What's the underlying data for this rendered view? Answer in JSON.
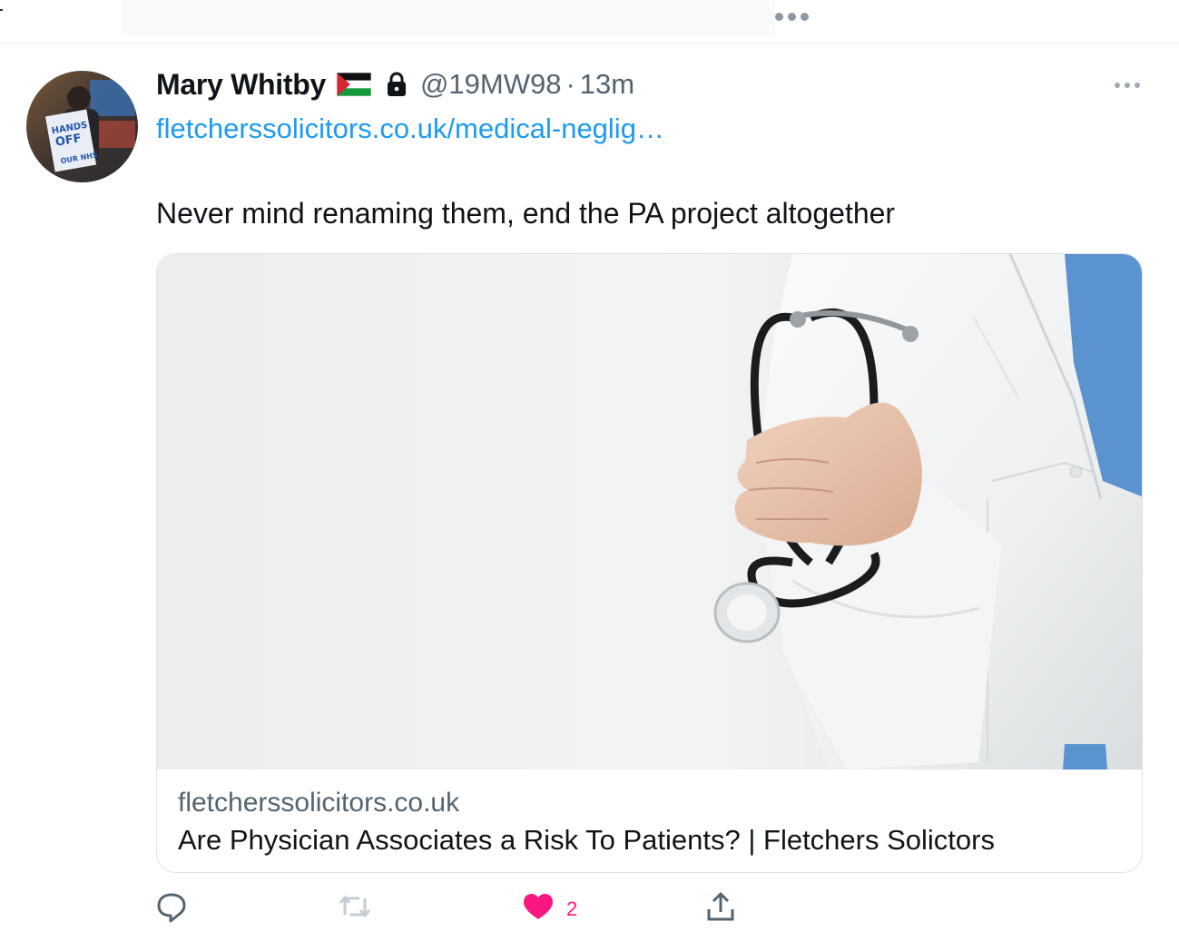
{
  "tweet": {
    "author_name": "Mary Whitby",
    "handle": "@19MW98",
    "separator": "·",
    "time": "13m",
    "link_text": "fletcherssolicitors.co.uk/medical-neglig…",
    "text": "Never mind renaming them, end the PA project altogether",
    "flag_icon": "palestine-flag-icon",
    "protected_icon": "lock-icon"
  },
  "card": {
    "domain": "fletcherssolicitors.co.uk",
    "title": "Are Physician Associates a Risk To Patients? | Fletchers Solictors",
    "image": "doctor-with-stethoscope-image"
  },
  "actions": {
    "reply_icon": "reply-icon",
    "retweet_icon": "retweet-icon",
    "like_icon": "heart-icon",
    "like_count": "2",
    "share_icon": "share-icon"
  },
  "colors": {
    "link": "#1d9bf0",
    "secondary_text": "#536471",
    "like": "#f91880",
    "border": "#dfe3e6"
  }
}
